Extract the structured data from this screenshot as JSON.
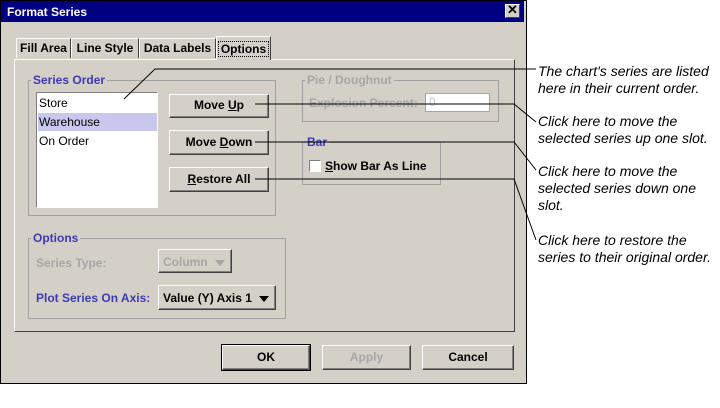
{
  "dialog": {
    "title": "Format Series"
  },
  "tabs": [
    {
      "label": "Fill Area"
    },
    {
      "label": "Line Style"
    },
    {
      "label": "Data Labels"
    },
    {
      "label": "Options"
    }
  ],
  "series_order": {
    "legend": "Series Order",
    "items": [
      "Store",
      "Warehouse",
      "On Order"
    ],
    "selected": "Warehouse",
    "move_up": {
      "pre": "Move ",
      "key": "U",
      "post": "p"
    },
    "move_down": {
      "pre": "Move ",
      "key": "D",
      "post": "own"
    },
    "restore_all": {
      "pre": "",
      "key": "R",
      "post": "estore All"
    }
  },
  "pie": {
    "legend": "Pie / Doughnut",
    "explosion_label": "Explosion Percent:",
    "explosion_value": "0"
  },
  "bar": {
    "legend": "Bar",
    "checkbox_label_key": "S",
    "checkbox_label_rest": "how Bar As Line",
    "checked": false
  },
  "options": {
    "legend": "Options",
    "series_type_label": "Series Type:",
    "series_type_value": "Column",
    "axis_label": "Plot Series On Axis:",
    "axis_value": "Value (Y) Axis 1"
  },
  "footer": {
    "ok": "OK",
    "apply": "Apply",
    "cancel": "Cancel"
  },
  "callouts": [
    {
      "line1": "The chart's series are listed",
      "line2": "here in their current order."
    },
    {
      "line1": "Click here to move the",
      "line2": "selected series up one slot."
    },
    {
      "line1": "Click here to move the",
      "line2": "selected series down one",
      "line3": "slot."
    },
    {
      "line1": "Click here to restore the",
      "line2": "series to their original order."
    }
  ],
  "colors": {
    "titlebar": "#000080",
    "dialog_bg": "#d4d0c8",
    "accent_label": "#3b3bb5",
    "selection": "#c8c8ee"
  }
}
